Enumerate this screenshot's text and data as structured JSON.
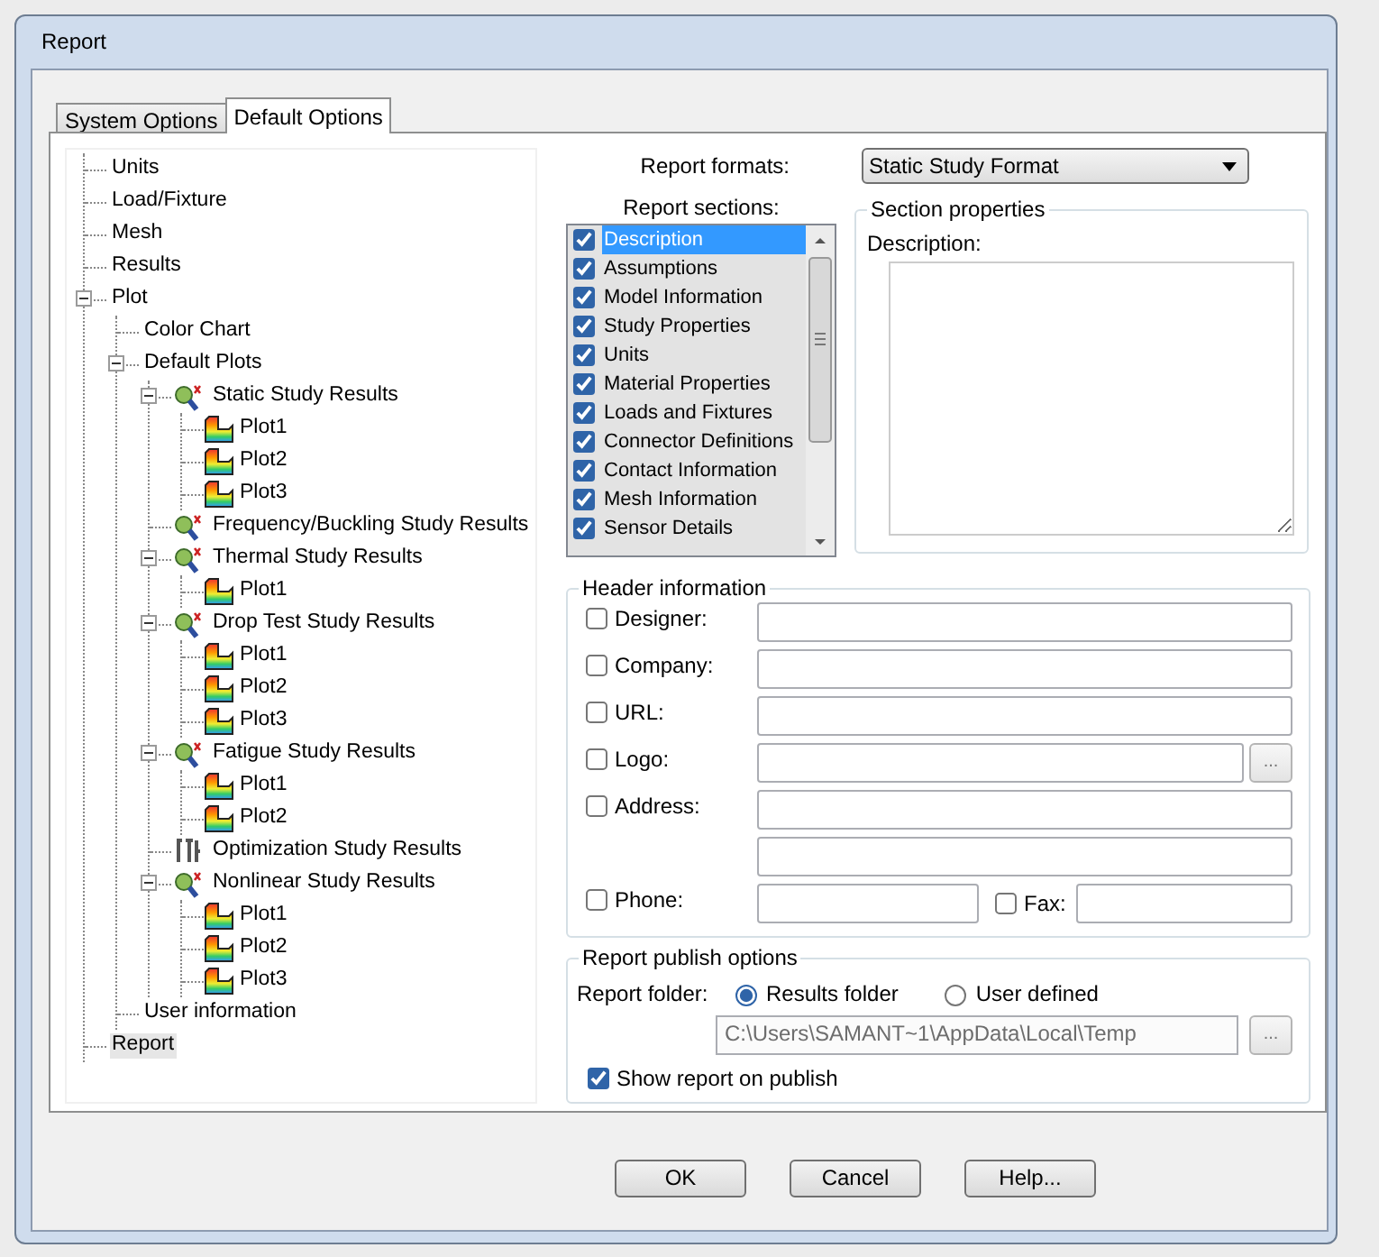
{
  "window": {
    "title": "Report"
  },
  "tabs": [
    {
      "label": "System Options",
      "selected": false
    },
    {
      "label": "Default Options",
      "selected": true
    }
  ],
  "tree": [
    {
      "label": "Units",
      "selected": false
    },
    {
      "label": "Load/Fixture",
      "selected": false
    },
    {
      "label": "Mesh",
      "selected": false
    },
    {
      "label": "Results",
      "selected": false
    },
    {
      "label": "Plot",
      "selected": false,
      "expanded": true,
      "children": [
        {
          "label": "Color Chart",
          "selected": false
        },
        {
          "label": "Default Plots",
          "selected": false,
          "expanded": true,
          "children": [
            {
              "label": "Static Study Results",
              "kind": "study",
              "selected": false,
              "expanded": true,
              "children": [
                {
                  "label": "Plot1",
                  "kind": "plot",
                  "selected": false
                },
                {
                  "label": "Plot2",
                  "kind": "plot",
                  "selected": false
                },
                {
                  "label": "Plot3",
                  "kind": "plot",
                  "selected": false
                }
              ]
            },
            {
              "label": "Frequency/Buckling Study Results",
              "kind": "study",
              "selected": false
            },
            {
              "label": "Thermal Study Results",
              "kind": "study",
              "selected": false,
              "expanded": true,
              "children": [
                {
                  "label": "Plot1",
                  "kind": "plot",
                  "selected": false
                }
              ]
            },
            {
              "label": "Drop Test Study Results",
              "kind": "study",
              "selected": false,
              "expanded": true,
              "children": [
                {
                  "label": "Plot1",
                  "kind": "plot",
                  "selected": false
                },
                {
                  "label": "Plot2",
                  "kind": "plot",
                  "selected": false
                },
                {
                  "label": "Plot3",
                  "kind": "plot",
                  "selected": false
                }
              ]
            },
            {
              "label": "Fatigue Study Results",
              "kind": "study",
              "selected": false,
              "expanded": true,
              "children": [
                {
                  "label": "Plot1",
                  "kind": "plot",
                  "selected": false
                },
                {
                  "label": "Plot2",
                  "kind": "plot",
                  "selected": false
                }
              ]
            },
            {
              "label": "Optimization Study Results",
              "kind": "optimization",
              "selected": false
            },
            {
              "label": "Nonlinear Study Results",
              "kind": "study",
              "selected": false,
              "expanded": true,
              "children": [
                {
                  "label": "Plot1",
                  "kind": "plot",
                  "selected": false
                },
                {
                  "label": "Plot2",
                  "kind": "plot",
                  "selected": false
                },
                {
                  "label": "Plot3",
                  "kind": "plot",
                  "selected": false
                }
              ]
            }
          ]
        },
        {
          "label": "User information",
          "selected": false
        }
      ]
    },
    {
      "label": "Report",
      "selected": true
    }
  ],
  "report_formats": {
    "label": "Report formats:",
    "value": "Static Study Format"
  },
  "report_sections": {
    "label": "Report sections:",
    "items": [
      {
        "label": "Description",
        "checked": true,
        "selected": true
      },
      {
        "label": "Assumptions",
        "checked": true,
        "selected": false
      },
      {
        "label": "Model Information",
        "checked": true,
        "selected": false
      },
      {
        "label": "Study Properties",
        "checked": true,
        "selected": false
      },
      {
        "label": "Units",
        "checked": true,
        "selected": false
      },
      {
        "label": "Material Properties",
        "checked": true,
        "selected": false
      },
      {
        "label": "Loads and Fixtures",
        "checked": true,
        "selected": false
      },
      {
        "label": "Connector Definitions",
        "checked": true,
        "selected": false
      },
      {
        "label": "Contact Information",
        "checked": true,
        "selected": false
      },
      {
        "label": "Mesh Information",
        "checked": true,
        "selected": false
      },
      {
        "label": "Sensor Details",
        "checked": true,
        "selected": false
      }
    ]
  },
  "section_properties": {
    "title": "Section properties",
    "label": "Description:"
  },
  "header_information": {
    "title": "Header information",
    "rows": [
      {
        "label": "Designer:",
        "checked": false,
        "kind": "text"
      },
      {
        "label": "Company:",
        "checked": false,
        "kind": "text"
      },
      {
        "label": "URL:",
        "checked": false,
        "kind": "text"
      },
      {
        "label": "Logo:",
        "checked": false,
        "kind": "browse",
        "browse_label": "..."
      },
      {
        "label": "Address:",
        "checked": false,
        "kind": "address"
      },
      {
        "label": "Phone:",
        "checked": false,
        "kind": "phone",
        "fax": {
          "label": "Fax:",
          "checked": false
        }
      }
    ]
  },
  "publish": {
    "title": "Report publish options",
    "folder_label": "Report folder:",
    "options": [
      {
        "label": "Results folder",
        "selected": true
      },
      {
        "label": "User defined",
        "selected": false
      }
    ],
    "path": {
      "value": "C:\\Users\\SAMANT~1\\AppData\\Local\\Temp",
      "disabled": true
    },
    "browse_label": "...",
    "show_report": {
      "label": "Show report on publish",
      "checked": true
    }
  },
  "buttons": [
    "OK",
    "Cancel",
    "Help..."
  ]
}
